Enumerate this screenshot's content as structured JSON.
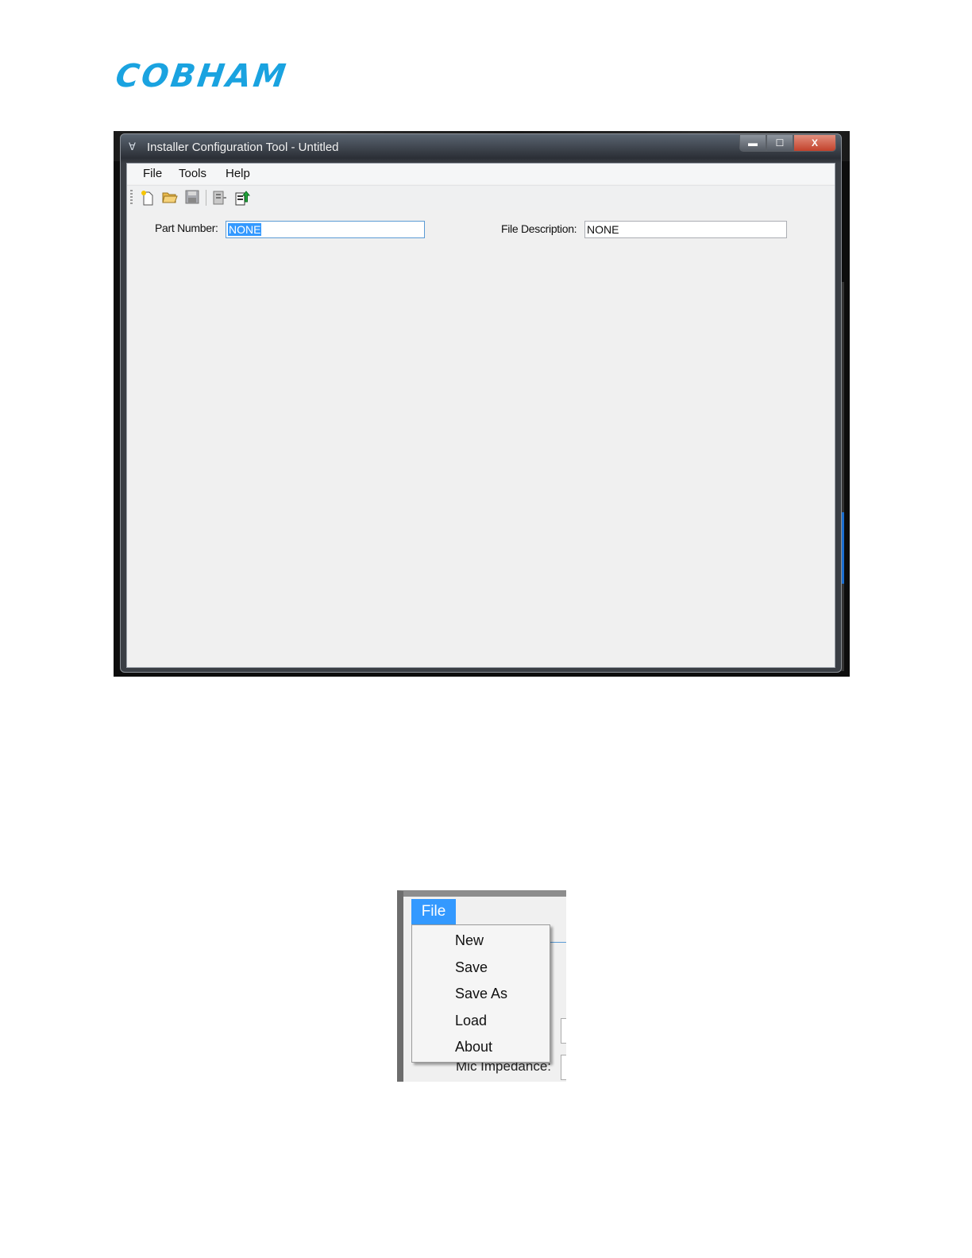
{
  "logo": {
    "text": "COBHAM"
  },
  "window": {
    "title": "Installer Configuration Tool - Untitled",
    "controls": {
      "minimize": "▬",
      "maximize": "☐",
      "close": "X"
    }
  },
  "menu": {
    "file": "File",
    "tools": "Tools",
    "help": "Help"
  },
  "toolbar": {
    "icons": [
      "new-file-icon",
      "open-folder-icon",
      "save-icon",
      "export-icon",
      "upload-icon"
    ]
  },
  "form": {
    "part_number_label": "Part Number:",
    "part_number_value": "NONE",
    "file_description_label": "File Description:",
    "file_description_value": "NONE"
  },
  "file_menu": {
    "header": "File",
    "items": [
      "New",
      "Save",
      "Save As",
      "Load",
      "About"
    ],
    "background_label": "Mic Impedance:"
  },
  "colors": {
    "brand": "#1aa3e0",
    "selection": "#3399ff",
    "window_bg": "#f0f0f0"
  }
}
